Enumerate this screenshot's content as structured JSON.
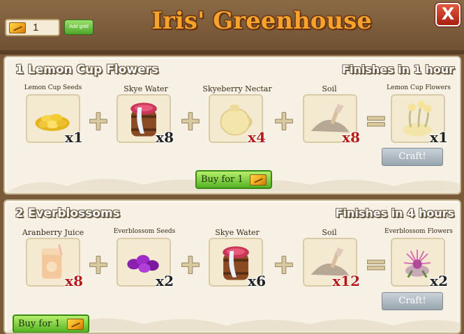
{
  "header": {
    "title": "Iris' Greenhouse",
    "currency_amount": "1",
    "add_button_label": "Add gold",
    "close_label": "X"
  },
  "recipes": [
    {
      "title": "1 Lemon Cup Flowers",
      "time": "Finishes in 1 hour",
      "ingredients": [
        {
          "label": "Lemon Cup Seeds",
          "qty": "x1",
          "icon": "lemon-cup-seeds-icon"
        },
        {
          "label": "Skye Water",
          "qty": "x8",
          "icon": "skye-water-icon"
        },
        {
          "label": "Skyeberry Nectar",
          "qty": "x4",
          "icon": "skyeberry-nectar-icon"
        },
        {
          "label": "Soil",
          "qty": "x8",
          "icon": "soil-icon"
        }
      ],
      "result": {
        "label": "Lemon Cup Flowers",
        "qty": "x1",
        "icon": "lemon-cup-flowers-icon"
      },
      "craft_label": "Craft!",
      "buy_label": "Buy for 1"
    },
    {
      "title": "2 Everblossoms",
      "time": "Finishes in 4 hours",
      "ingredients": [
        {
          "label": "Aranberry Juice",
          "qty": "x8",
          "icon": "aranberry-juice-icon"
        },
        {
          "label": "Everblossom Seeds",
          "qty": "x2",
          "icon": "everblossom-seeds-icon"
        },
        {
          "label": "Skye Water",
          "qty": "x6",
          "icon": "skye-water-icon"
        },
        {
          "label": "Soil",
          "qty": "x12",
          "icon": "soil-icon"
        }
      ],
      "result": {
        "label": "Everblossom Flowers",
        "qty": "x2",
        "icon": "everblossom-flowers-icon"
      },
      "craft_label": "Craft!",
      "buy_label": "Buy for 1"
    }
  ],
  "operators": {
    "plus": "+",
    "equals": "="
  },
  "colors": {
    "title_orange": "#f7a22c",
    "panel_bg": "#f6f1e4",
    "missing_red": "#b51a14",
    "buy_green": "#54b222",
    "craft_grey": "#98a5ae"
  }
}
